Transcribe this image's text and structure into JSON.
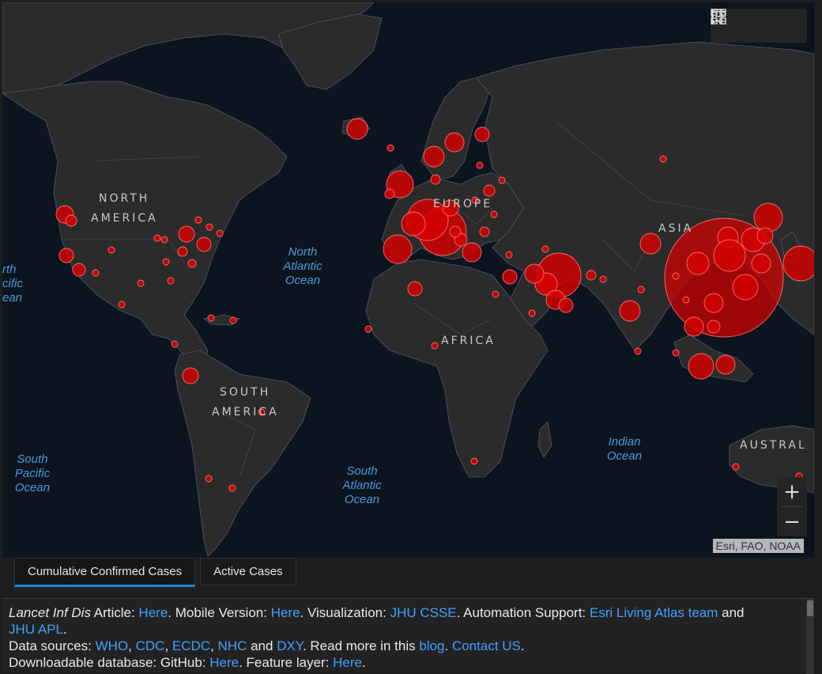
{
  "map": {
    "continents": [
      {
        "id": "north-america-line1",
        "text": "NORTH"
      },
      {
        "id": "north-america-line2",
        "text": "AMERICA"
      },
      {
        "id": "south-america-line1",
        "text": "SOUTH"
      },
      {
        "id": "south-america-line2",
        "text": "AMERICA"
      },
      {
        "id": "europe",
        "text": "EUROPE"
      },
      {
        "id": "asia",
        "text": "ASIA"
      },
      {
        "id": "africa",
        "text": "AFRICA"
      },
      {
        "id": "australia",
        "text": "AUSTRAL"
      }
    ],
    "oceans": [
      {
        "id": "north-atlantic",
        "lines": [
          "North",
          "Atlantic",
          "Ocean"
        ]
      },
      {
        "id": "south-atlantic",
        "lines": [
          "South",
          "Atlantic",
          "Ocean"
        ]
      },
      {
        "id": "south-pacific",
        "lines": [
          "South",
          "Pacific",
          "Ocean"
        ]
      },
      {
        "id": "indian",
        "lines": [
          "Indian",
          "Ocean"
        ]
      },
      {
        "id": "north-pacific-partial",
        "lines": [
          "rth",
          "cific",
          "ean"
        ]
      }
    ],
    "attribution": "Esri, FAO, NOAA",
    "zoom_in": "+",
    "zoom_out": "−",
    "colors": {
      "ocean": "#0c1420",
      "land": "#2b2b2b",
      "border": "#5a5a6e",
      "bubble": "#d60000",
      "bubble_stroke": "#ff6b6b"
    }
  },
  "toolbar": {
    "icons": [
      "bookmark-icon",
      "legend-list-icon",
      "basemap-gallery-icon"
    ]
  },
  "tabs": [
    {
      "label": "Cumulative Confirmed Cases",
      "active": true
    },
    {
      "label": "Active Cases",
      "active": false
    }
  ],
  "info": {
    "line1": {
      "journal": "Lancet Inf Dis",
      "t1": " Article: ",
      "a1": "Here",
      "t2": ". Mobile Version: ",
      "a2": "Here",
      "t3": ". Visualization: ",
      "a3": "JHU CSSE",
      "t4": ". Automation Support: ",
      "a4": "Esri Living Atlas team",
      "t5": " and"
    },
    "line2": {
      "a1": "JHU APL",
      "t1": "."
    },
    "line3": {
      "t1": "Data sources: ",
      "a1": "WHO",
      "s1": ", ",
      "a2": "CDC",
      "s2": ", ",
      "a3": "ECDC",
      "s3": ", ",
      "a4": "NHC",
      "s4": " and ",
      "a5": "DXY",
      "t2": ". Read more in this ",
      "a6": "blog",
      "t3": ". ",
      "a7": "Contact US",
      "t4": "."
    },
    "line4": {
      "t1": "Downloadable database: GitHub: ",
      "a1": "Here",
      "t2": ". Feature layer: ",
      "a2": "Here",
      "t3": "."
    }
  }
}
